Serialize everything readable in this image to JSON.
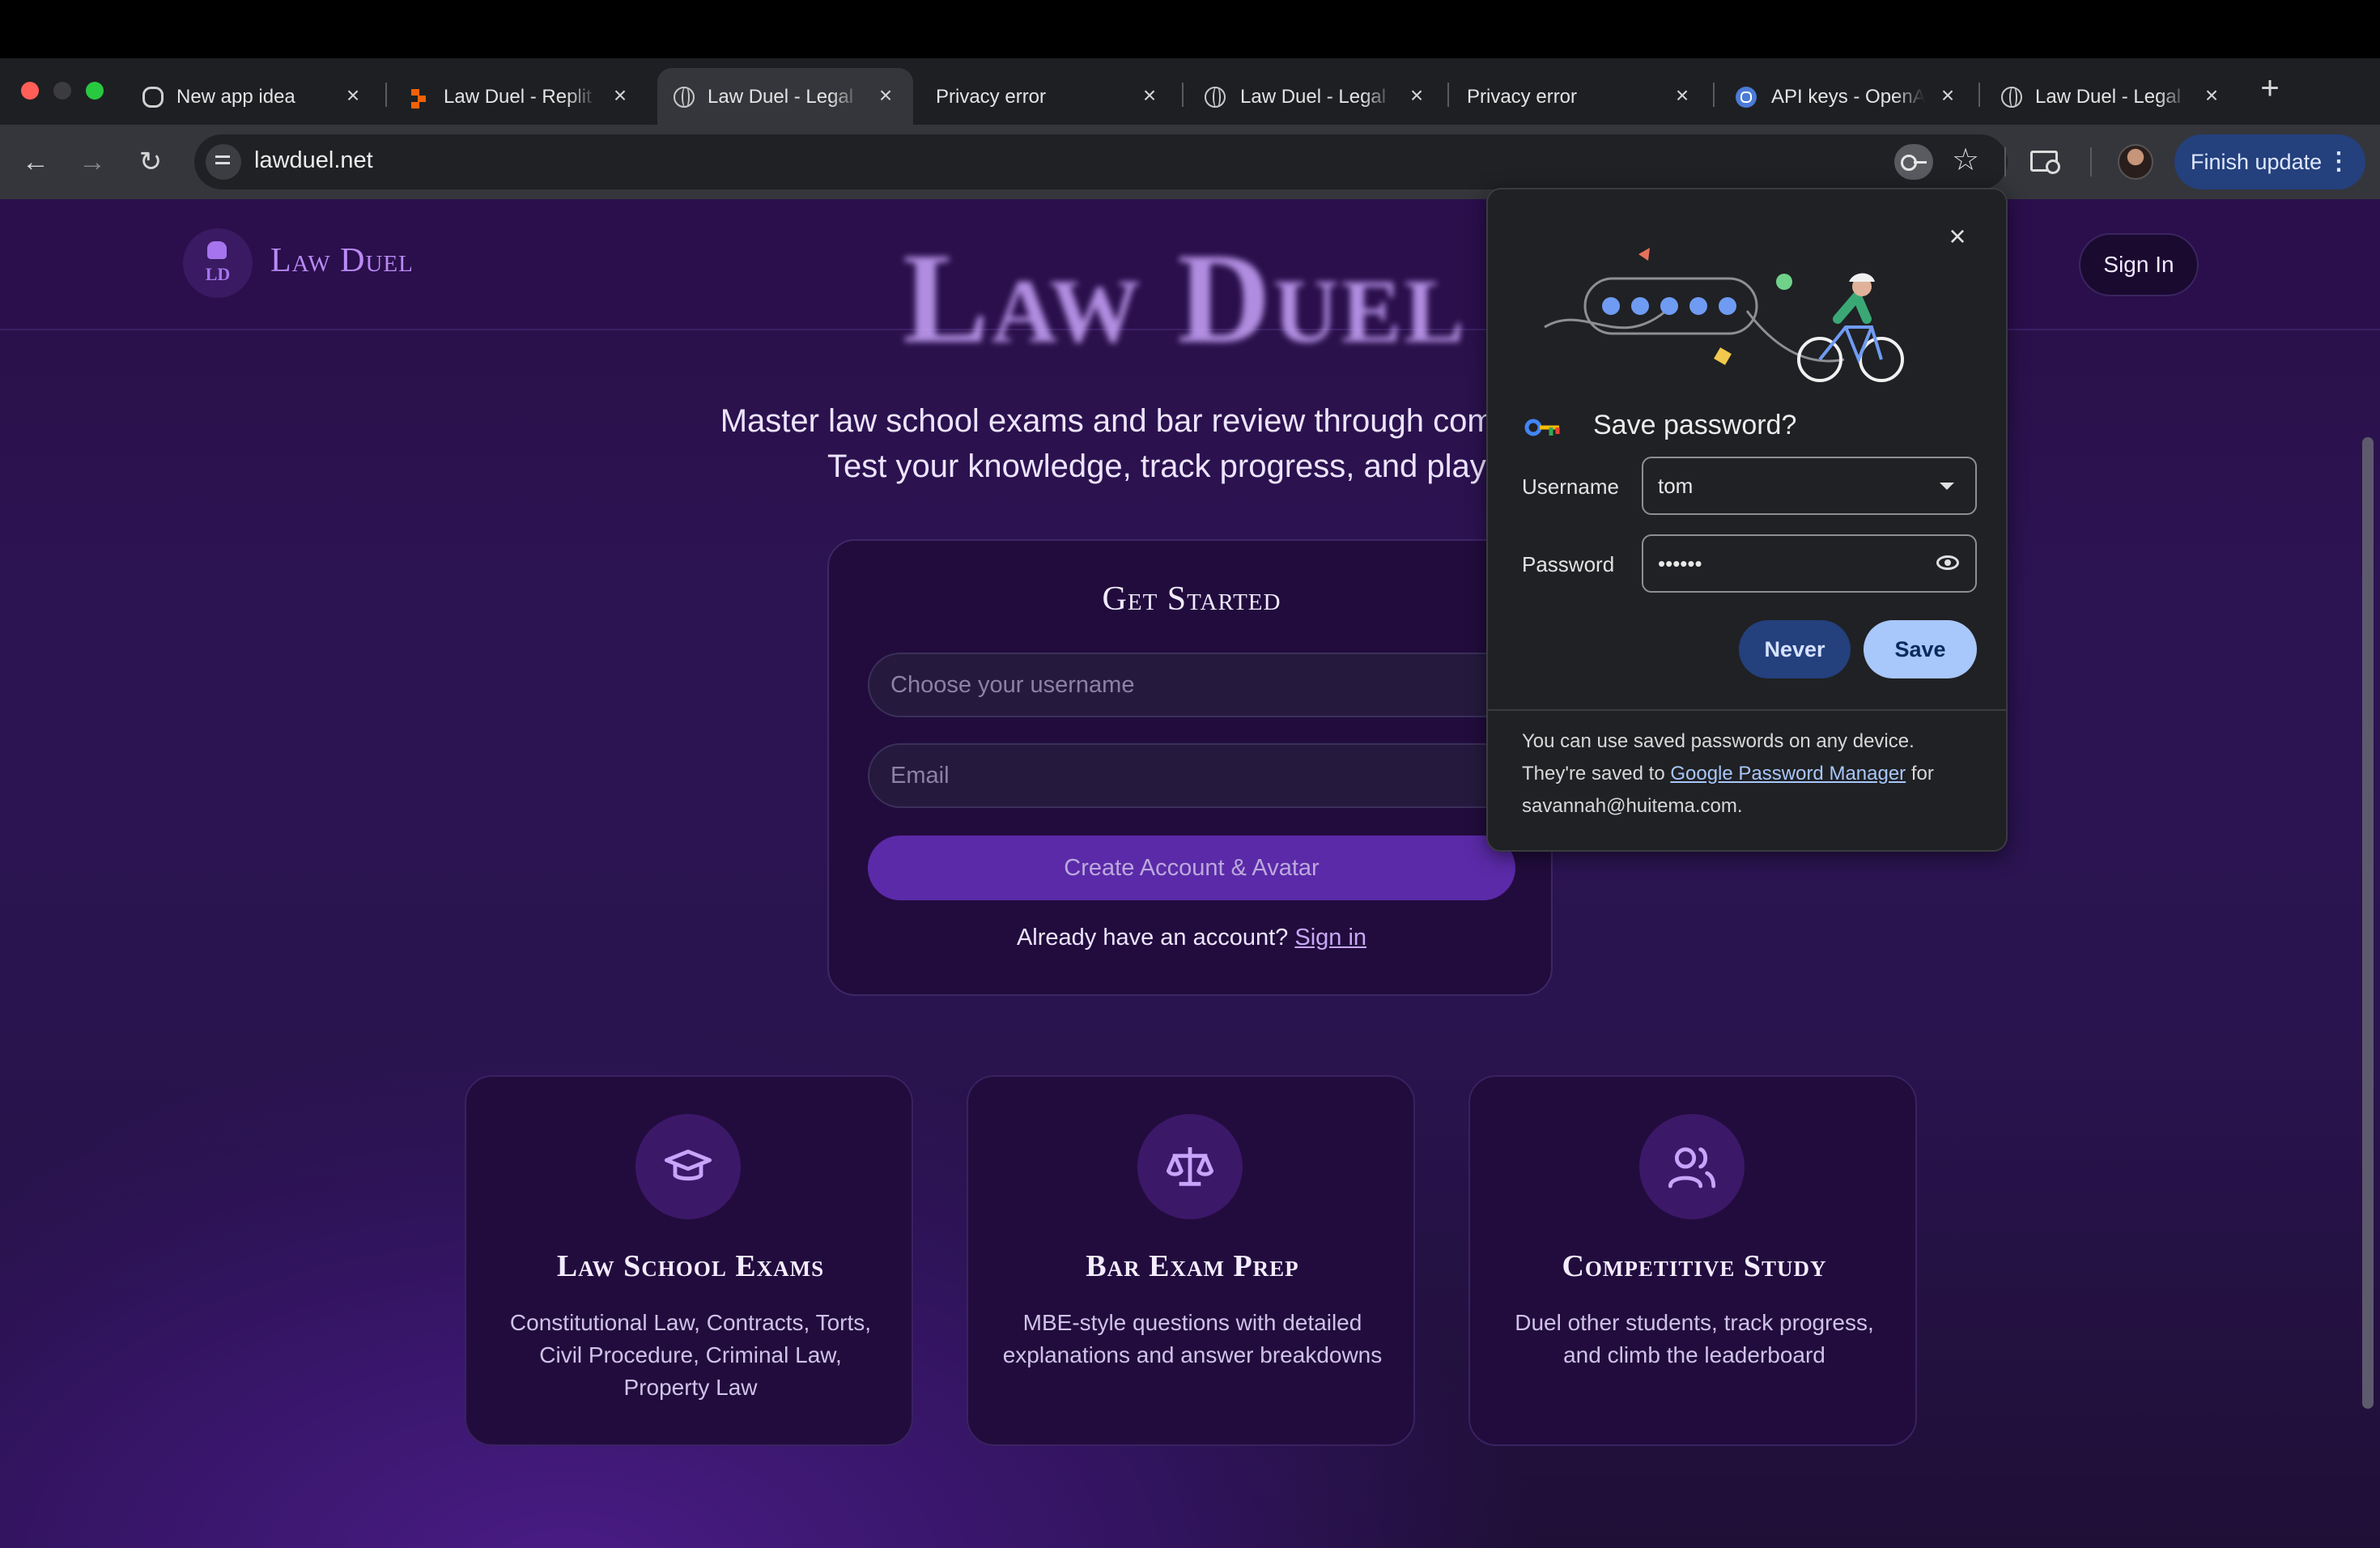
{
  "browser": {
    "tabs": [
      {
        "title": "New app idea",
        "icon": "openai-icon"
      },
      {
        "title": "Law Duel - Replit",
        "icon": "replit-icon"
      },
      {
        "title": "Law Duel - Legal",
        "icon": "globe-icon",
        "active": true
      },
      {
        "title": "Privacy error",
        "icon": "none"
      },
      {
        "title": "Law Duel - Legal",
        "icon": "globe-icon"
      },
      {
        "title": "Privacy error",
        "icon": "none"
      },
      {
        "title": "API keys - OpenAI",
        "icon": "openai-icon"
      },
      {
        "title": "Law Duel - Legal",
        "icon": "globe-icon"
      }
    ],
    "new_tab_symbol": "+",
    "url": "lawduel.net",
    "finish_update_label": "Finish update",
    "colors": {
      "finish_update_bg": "#24407d",
      "toolbar": "#35363b",
      "tabstrip": "#1e1f23"
    }
  },
  "site": {
    "brand": "Law Duel",
    "logo_initials": "LD",
    "hero_title": "Law Duel",
    "sign_in_button": "Sign In",
    "subtitle_line1": "Master law school exams and bar review through competitive due",
    "subtitle_line2": "Test your knowledge, track progress, and play with",
    "get_started": {
      "title": "Get Started",
      "username_placeholder": "Choose your username",
      "email_placeholder": "Email",
      "create_button": "Create Account & Avatar",
      "already_text": "Already have an account?",
      "sign_in_link": "Sign in"
    },
    "features": [
      {
        "icon": "graduation-cap-icon",
        "title": "Law School Exams",
        "description": "Constitutional Law, Contracts, Torts, Civil Procedure, Criminal Law, Property Law"
      },
      {
        "icon": "scales-icon",
        "title": "Bar Exam Prep",
        "description": "MBE-style questions with detailed explanations and answer breakdowns"
      },
      {
        "icon": "users-icon",
        "title": "Competitive Study",
        "description": "Duel other students, track progress, and climb the leaderboard"
      }
    ],
    "colors": {
      "accent": "#b98af5",
      "background": "#2a1048",
      "card": "#220c3d",
      "button": "#5b2aa8"
    }
  },
  "password_popup": {
    "title": "Save password?",
    "username_label": "Username",
    "username_value": "tom",
    "password_label": "Password",
    "password_value": "••••••",
    "never_button": "Never",
    "save_button": "Save",
    "footer_text_1": "You can use saved passwords on any device. They're saved to",
    "footer_link": "Google Password Manager",
    "footer_text_2": "for savannah@huitema.com."
  }
}
